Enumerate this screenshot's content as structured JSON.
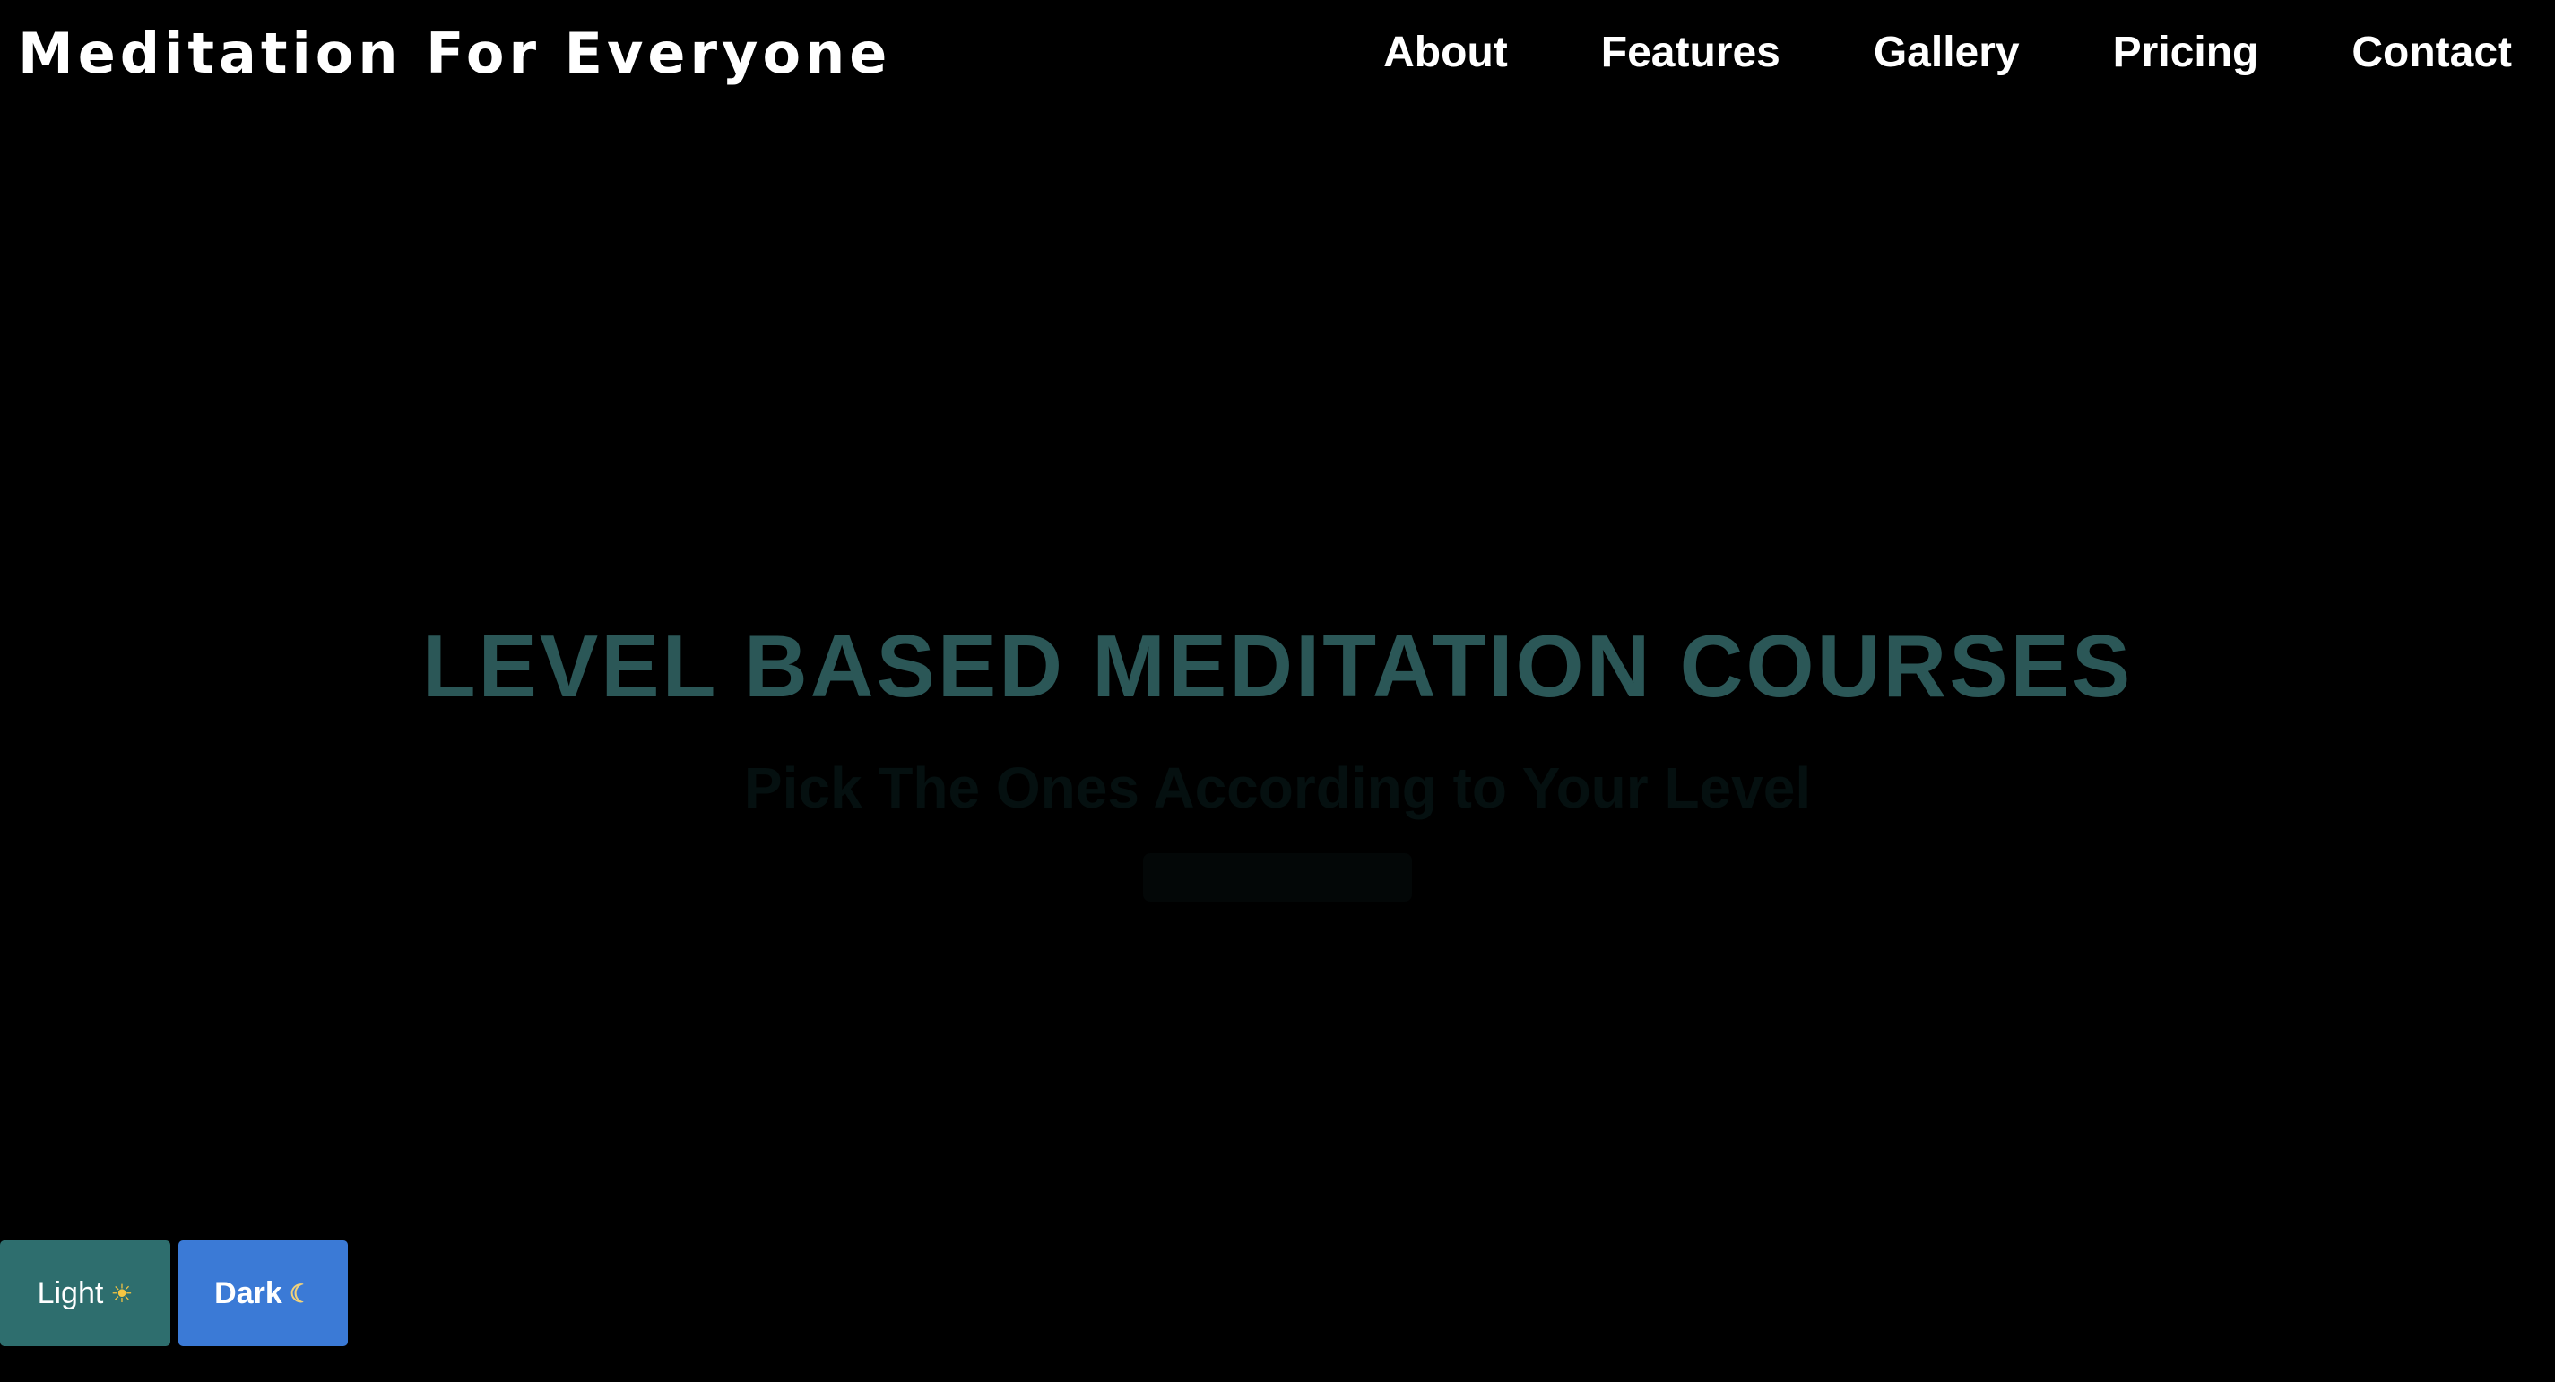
{
  "header": {
    "brand": "Meditation For Everyone",
    "nav": [
      "About",
      "Features",
      "Gallery",
      "Pricing",
      "Contact"
    ]
  },
  "hero": {
    "title": "LEVEL BASED MEDITATION COURSES",
    "subtitle": "Pick The Ones According to Your Level"
  },
  "theme_switch": {
    "light_label": "Light",
    "light_icon": "☀",
    "dark_label": "Dark",
    "dark_icon": "☾"
  },
  "colors": {
    "background": "#000000",
    "hero_title": "#2b5757",
    "light_button": "#2e6e6e",
    "dark_button": "#3b7ad6"
  }
}
